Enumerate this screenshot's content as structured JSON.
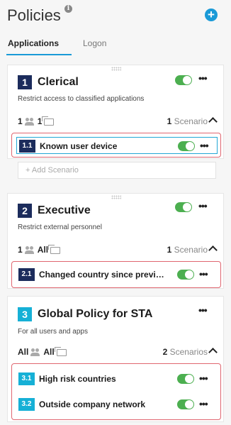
{
  "header": {
    "title": "Policies",
    "info_glyph": "i",
    "add_glyph": "+"
  },
  "tabs": [
    {
      "label": "Applications",
      "active": true
    },
    {
      "label": "Logon",
      "active": false
    }
  ],
  "policies": [
    {
      "number": "1",
      "name": "Clerical",
      "description": "Restrict access to classified applications",
      "users": "1",
      "apps": "1",
      "scenario_count": "1",
      "scenario_word": "Scenario",
      "enabled": true,
      "scenarios": [
        {
          "number": "1.1",
          "label": "Known user device",
          "enabled": true,
          "selected": true
        }
      ],
      "add_scenario_label": "+ Add Scenario"
    },
    {
      "number": "2",
      "name": "Executive",
      "description": "Restrict external personnel",
      "users": "1",
      "apps": "All",
      "scenario_count": "1",
      "scenario_word": "Scenario",
      "enabled": true,
      "scenarios": [
        {
          "number": "2.1",
          "label": "Changed country since previ…",
          "enabled": true
        }
      ]
    },
    {
      "number": "3",
      "name": "Global Policy for STA",
      "description": "For all users and apps",
      "users": "All",
      "apps": "All",
      "scenario_count": "2",
      "scenario_word": "Scenarios",
      "scenarios": [
        {
          "number": "3.1",
          "label": "High risk countries",
          "enabled": true
        },
        {
          "number": "3.2",
          "label": "Outside company network",
          "enabled": true
        }
      ]
    }
  ],
  "more_glyph": "•••",
  "colors": {
    "accent": "#1a9ad7",
    "toggle_on": "#4caf50",
    "dark_badge": "#1c2c5c",
    "blue_badge": "#16b0d6",
    "highlight": "#e06670"
  }
}
